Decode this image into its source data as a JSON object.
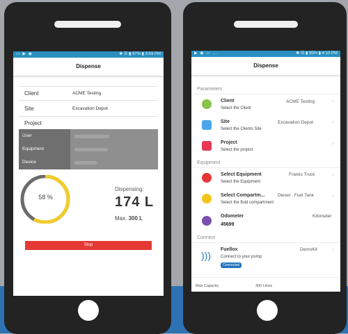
{
  "left": {
    "status": {
      "icons": "▭ ▶ ◉",
      "right": "✱ ☰ ▮ 97% ▮ 3:59 PM"
    },
    "title": "Dispense",
    "fields": [
      {
        "label": "Client",
        "value": "ACME Testing"
      },
      {
        "label": "Site",
        "value": "Excavation Depot"
      },
      {
        "label": "Project",
        "value": ""
      }
    ],
    "greyed": [
      "User",
      "Equipment",
      "Device"
    ],
    "gauge": {
      "percent": 58,
      "text": "58 %"
    },
    "dispensing_label": "Dispensing:",
    "dispensing_value": "174 L",
    "max_label": "Max.",
    "max_value": "300 L",
    "stop_label": "Stop",
    "colors": {
      "gauge_fill": "#f2cc2a",
      "gauge_track": "#6b6b6b",
      "stop": "#e53935"
    }
  },
  "right": {
    "status": {
      "icons": "▶ ◉ ▭ …",
      "right": "✱ ☰ ▮ 95% ▮ 4:10 PM"
    },
    "title": "Dispense",
    "sections": {
      "parameters": "Parameters",
      "equipment": "Equipment",
      "connect": "Connect"
    },
    "rows": {
      "client": {
        "title": "Client",
        "sub": "Select the Client",
        "value": "ACME Testing"
      },
      "site": {
        "title": "Site",
        "sub": "Select the Clients Site",
        "value": "Excavation Depot"
      },
      "project": {
        "title": "Project",
        "sub": "Select the project",
        "value": ""
      },
      "equipment": {
        "title": "Select Equipment",
        "sub": "Select the Equipment",
        "value": "Franks Truck"
      },
      "compartment": {
        "title": "Select Compartm...",
        "sub": "Select the fluid compartment",
        "value": "Diesel · Fuel Tank"
      },
      "odometer": {
        "title": "Odometer",
        "sub": "45699",
        "value": "Kilometer"
      },
      "fuellox": {
        "title": "Fuellox",
        "sub": "Connect to your pump",
        "value": "DemoKit",
        "badge": "Connected"
      }
    },
    "max_capacity_label": "Max Capacity",
    "max_capacity_value": "300 Litres",
    "icon_names": [
      "leaf-icon",
      "layers-icon",
      "briefcase-icon",
      "gear-icon",
      "fuel-icon",
      "gauge-icon",
      "wifi-icon"
    ]
  }
}
